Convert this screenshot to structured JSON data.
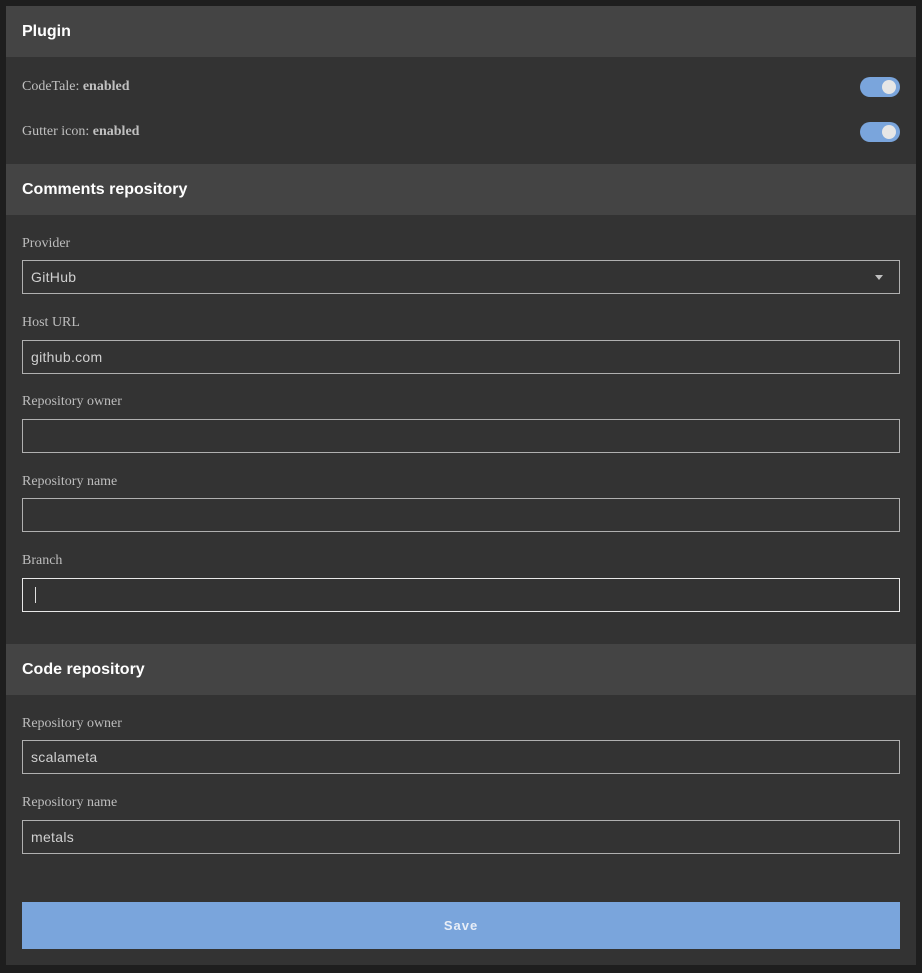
{
  "plugin": {
    "header": "Plugin",
    "codetale": {
      "label": "CodeTale: ",
      "state": "enabled",
      "on": true
    },
    "gutter_icon": {
      "label": "Gutter icon: ",
      "state": "enabled",
      "on": true
    }
  },
  "comments_repository": {
    "header": "Comments repository",
    "provider": {
      "label": "Provider",
      "value": "GitHub",
      "icon": "chevron-down-icon"
    },
    "host_url": {
      "label": "Host URL",
      "value": "github.com"
    },
    "repository_owner": {
      "label": "Repository owner",
      "value": ""
    },
    "repository_name": {
      "label": "Repository name",
      "value": ""
    },
    "branch": {
      "label": "Branch",
      "value": ""
    }
  },
  "code_repository": {
    "header": "Code repository",
    "repository_owner": {
      "label": "Repository owner",
      "value": "scalameta"
    },
    "repository_name": {
      "label": "Repository name",
      "value": "metals"
    }
  },
  "save_label": "Save",
  "colors": {
    "accent": "#7aa5dc",
    "panel_bg": "#333333",
    "header_bg": "#444444"
  }
}
